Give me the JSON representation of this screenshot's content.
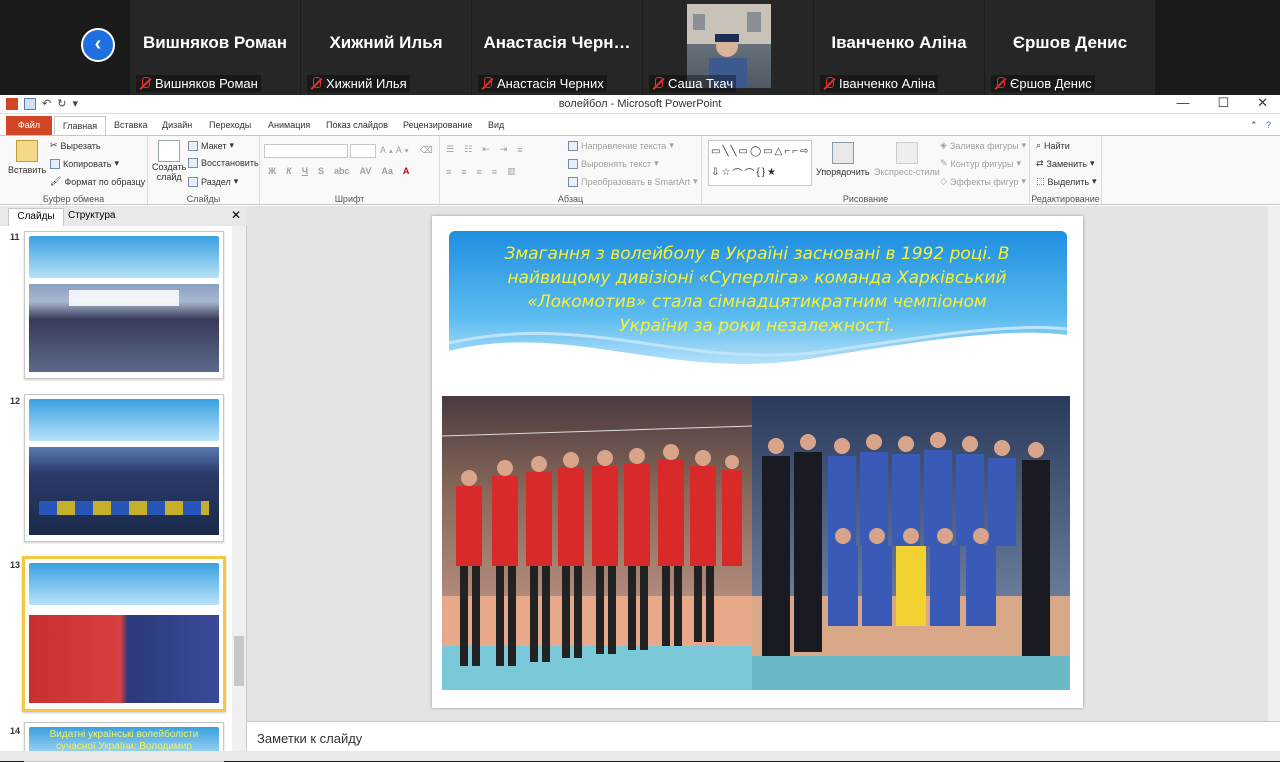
{
  "zoom": {
    "participants": [
      {
        "big": "Вишняков Роман",
        "small": "Вишняков Роман"
      },
      {
        "big": "Хижний Илья",
        "small": "Хижний Илья"
      },
      {
        "big": "Анастасія Черн…",
        "small": "Анастасія Черних"
      },
      {
        "big": "",
        "small": "Саша Ткач"
      },
      {
        "big": "Іванченко Аліна",
        "small": "Іванченко Аліна"
      },
      {
        "big": "Єршов Денис",
        "small": "Єршов Денис"
      }
    ]
  },
  "window": {
    "title": "волейбол - Microsoft PowerPoint"
  },
  "tabs": {
    "file": "Файл",
    "home": "Главная",
    "insert": "Вставка",
    "design": "Дизайн",
    "transitions": "Переходы",
    "animation": "Анимация",
    "slideshow": "Показ слайдов",
    "review": "Рецензирование",
    "view": "Вид"
  },
  "ribbon": {
    "clipboard": {
      "paste": "Вставить",
      "cut": "Вырезать",
      "copy": "Копировать",
      "format_painter": "Формат по образцу",
      "label": "Буфер обмена"
    },
    "slides": {
      "new_slide": "Создать",
      "new_slide2": "слайд",
      "layout": "Макет",
      "reset": "Восстановить",
      "section": "Раздел",
      "label": "Слайды"
    },
    "font": {
      "label": "Шрифт"
    },
    "paragraph": {
      "text_direction": "Направление текста",
      "align_text": "Выровнять текст",
      "smartart": "Преобразовать в SmartArt",
      "label": "Абзац"
    },
    "drawing": {
      "arrange": "Упорядочить",
      "quick_styles": "Экспресс-стили",
      "fill": "Заливка фигуры",
      "outline": "Контур фигуры",
      "effects": "Эффекты фигур",
      "label": "Рисование"
    },
    "editing": {
      "find": "Найти",
      "replace": "Заменить",
      "select": "Выделить",
      "label": "Редактирование"
    }
  },
  "leftpane": {
    "tab_slides": "Слайды",
    "tab_outline": "Структура",
    "thumbs": [
      {
        "num": "11"
      },
      {
        "num": "12"
      },
      {
        "num": "13"
      },
      {
        "num": "14",
        "text": "Видатні українські волейболісти сучасної України: Володимир"
      }
    ]
  },
  "slide": {
    "text": "Змагання з волейболу в Україні засновані в 1992 році. В найвищому дивізіоні «Суперліга» команда Харківський «Локомотив» стала сімнадцятикратним чемпіоном України за роки незалежності."
  },
  "notes": {
    "placeholder": "Заметки к слайду"
  }
}
